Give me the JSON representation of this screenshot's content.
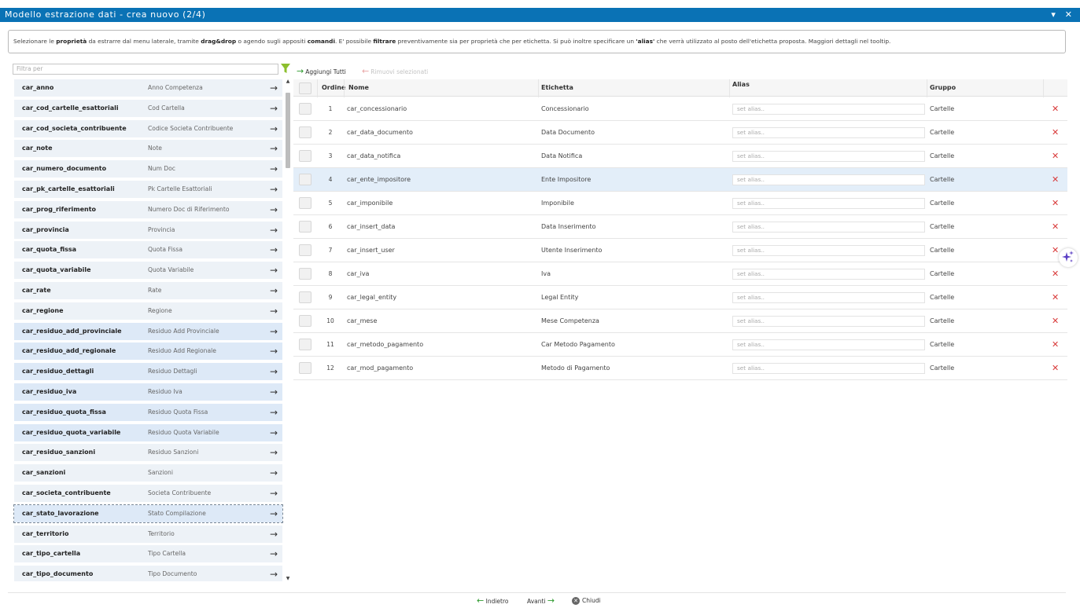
{
  "window": {
    "title": "Modello estrazione dati - crea nuovo (2/4)",
    "controls": "▾ ✕"
  },
  "info": {
    "p1": "Selezionare le ",
    "b1": "proprietà",
    "p2": " da estrarre dal menu laterale, tramite ",
    "b2": "drag&drop",
    "p3": " o agendo sugli appositi ",
    "b3": "comandi",
    "p4": ". E' possibile ",
    "b4": "filtrare",
    "p5": " preventivamente sia per proprietà che per etichetta. Si può inoltre specificare un ",
    "b5": "'alias'",
    "p6": " che verrà utilizzato al posto dell'etichetta proposta. Maggiori dettagli nel tooltip."
  },
  "filter": {
    "placeholder": "Filtra per",
    "icon": "filter-icon"
  },
  "left_items": [
    {
      "name": "car_anno",
      "label": "Anno Competenza"
    },
    {
      "name": "car_cod_cartelle_esattoriali",
      "label": "Cod Cartella"
    },
    {
      "name": "car_cod_societa_contribuente",
      "label": "Codice Societa Contribuente"
    },
    {
      "name": "car_note",
      "label": "Note"
    },
    {
      "name": "car_numero_documento",
      "label": "Num Doc"
    },
    {
      "name": "car_pk_cartelle_esattoriali",
      "label": "Pk Cartelle Esattoriali"
    },
    {
      "name": "car_prog_riferimento",
      "label": "Numero Doc di Riferimento"
    },
    {
      "name": "car_provincia",
      "label": "Provincia"
    },
    {
      "name": "car_quota_fissa",
      "label": "Quota Fissa"
    },
    {
      "name": "car_quota_variabile",
      "label": "Quota Variabile"
    },
    {
      "name": "car_rate",
      "label": "Rate"
    },
    {
      "name": "car_regione",
      "label": "Regione"
    },
    {
      "name": "car_residuo_add_provinciale",
      "label": "Residuo Add Provinciale"
    },
    {
      "name": "car_residuo_add_regionale",
      "label": "Residuo Add Regionale"
    },
    {
      "name": "car_residuo_dettagli",
      "label": "Residuo Dettagli"
    },
    {
      "name": "car_residuo_iva",
      "label": "Residuo Iva"
    },
    {
      "name": "car_residuo_quota_fissa",
      "label": "Residuo Quota Fissa"
    },
    {
      "name": "car_residuo_quota_variabile",
      "label": "Residuo Quota Variabile"
    },
    {
      "name": "car_residuo_sanzioni",
      "label": "Residuo Sanzioni"
    },
    {
      "name": "car_sanzioni",
      "label": "Sanzioni"
    },
    {
      "name": "car_societa_contribuente",
      "label": "Societa Contribuente"
    },
    {
      "name": "car_stato_lavorazione",
      "label": "Stato Compilazione"
    },
    {
      "name": "car_territorio",
      "label": "Territorio"
    },
    {
      "name": "car_tipo_cartella",
      "label": "Tipo Cartella"
    },
    {
      "name": "car_tipo_documento",
      "label": "Tipo Documento"
    }
  ],
  "toolbar": {
    "add_all": "Aggiungi Tutti",
    "remove_selected": "Rimuovi selezionati"
  },
  "grid": {
    "headers": {
      "order": "Ordine",
      "name": "Nome",
      "label": "Etichetta",
      "alias": "Alias",
      "group": "Gruppo"
    },
    "alias_placeholder": "set alias..",
    "rows": [
      {
        "order": "1",
        "name": "car_concessionario",
        "label": "Concessionario",
        "group": "Cartelle"
      },
      {
        "order": "2",
        "name": "car_data_documento",
        "label": "Data Documento",
        "group": "Cartelle"
      },
      {
        "order": "3",
        "name": "car_data_notifica",
        "label": "Data Notifica",
        "group": "Cartelle"
      },
      {
        "order": "4",
        "name": "car_ente_impositore",
        "label": "Ente Impositore",
        "group": "Cartelle"
      },
      {
        "order": "5",
        "name": "car_imponibile",
        "label": "Imponibile",
        "group": "Cartelle"
      },
      {
        "order": "6",
        "name": "car_insert_data",
        "label": "Data Inserimento",
        "group": "Cartelle"
      },
      {
        "order": "7",
        "name": "car_insert_user",
        "label": "Utente Inserimento",
        "group": "Cartelle"
      },
      {
        "order": "8",
        "name": "car_iva",
        "label": "Iva",
        "group": "Cartelle"
      },
      {
        "order": "9",
        "name": "car_legal_entity",
        "label": "Legal Entity",
        "group": "Cartelle"
      },
      {
        "order": "10",
        "name": "car_mese",
        "label": "Mese Competenza",
        "group": "Cartelle"
      },
      {
        "order": "11",
        "name": "car_metodo_pagamento",
        "label": "Car Metodo Pagamento",
        "group": "Cartelle"
      },
      {
        "order": "12",
        "name": "car_mod_pagamento",
        "label": "Metodo di Pagamento",
        "group": "Cartelle"
      }
    ]
  },
  "footer": {
    "back": "Indietro",
    "next": "Avanti",
    "close": "Chiudi"
  },
  "colors": {
    "titlebar": "#0a72b5",
    "list_bg": "#edf2f7",
    "list_selected": "#dde9f7",
    "row_highlight": "#e3eef9",
    "delete": "#d93a3a",
    "accent_green": "#2e9a2e"
  }
}
